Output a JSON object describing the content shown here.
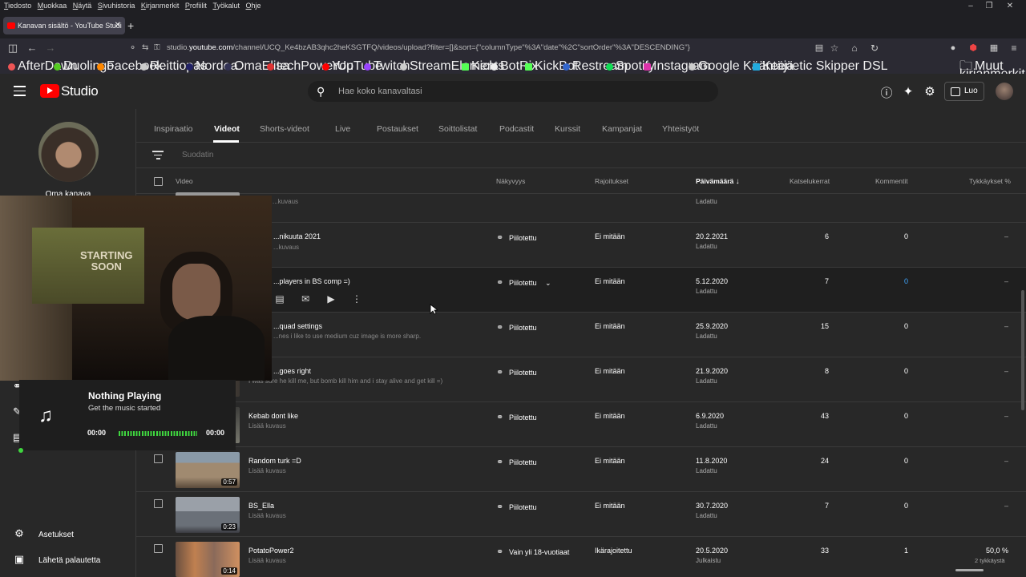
{
  "menubar": {
    "items": [
      "Tiedosto",
      "Muokkaa",
      "Näytä",
      "Sivuhistoria",
      "Kirjanmerkit",
      "Profiilit",
      "Työkalut",
      "Ohje"
    ]
  },
  "browser": {
    "tab_title": "Kanavan sisältö - YouTube Studi",
    "url_prefix": "studio.",
    "url_host": "youtube.com",
    "url_rest": "/channel/UCQ_Ke4bzAB3qhc2heKSGTFQ/videos/upload?filter=[]&sort={\"columnType\"%3A\"date\"%2C\"sortOrder\"%3A\"DESCENDING\"}",
    "bookmarks": [
      "AfterDawn",
      "Duolingo",
      "Facebook",
      "Reittiopas",
      "Nordea",
      "OmaElisa",
      "techPowerUp",
      "YouTube",
      "Twitch",
      "StreamElements",
      "Kick",
      "BotRix",
      "KickBot",
      "Restream",
      "Spotify",
      "Instagram",
      "Google Kääntäjä",
      "Keenetic Skipper DSL"
    ],
    "other_bookmarks": "Muut kirjanmerkit"
  },
  "header": {
    "logo_text": "Studio",
    "search_placeholder": "Hae koko kanavaltasi",
    "create_label": "Luo"
  },
  "sidebar": {
    "channel_name": "Oma kanava",
    "settings_label": "Asetukset",
    "feedback_label": "Lähetä palautetta",
    "partial_label": "Asetus"
  },
  "tabs": [
    "Inspiraatio",
    "Videot",
    "Shorts-videot",
    "Live",
    "Postaukset",
    "Soittolistat",
    "Podcastit",
    "Kurssit",
    "Kampanjat",
    "Yhteistyöt"
  ],
  "filter_placeholder": "Suodatin",
  "columns": {
    "video": "Video",
    "visibility": "Näkyvyys",
    "restrictions": "Rajoitukset",
    "date": "Päivämäärä",
    "views": "Katselukerrat",
    "comments": "Kommentit",
    "likes": "Tykkäykset %"
  },
  "rows": [
    {
      "title": "",
      "desc": "...kuvaus",
      "visibility": "",
      "restriction": "",
      "date": "",
      "status": "Ladattu",
      "views": "",
      "comments": "",
      "likes": ""
    },
    {
      "title": "...nikuuta 2021",
      "desc": "...kuvaus",
      "visibility": "Piilotettu",
      "restriction": "Ei mitään",
      "date": "20.2.2021",
      "status": "Ladattu",
      "views": "6",
      "comments": "0",
      "likes": "–"
    },
    {
      "title": "...players in BS comp =)",
      "desc": "",
      "visibility": "Piilotettu",
      "restriction": "Ei mitään",
      "date": "5.12.2020",
      "status": "Ladattu",
      "views": "7",
      "comments": "0",
      "likes": "–"
    },
    {
      "title": "...quad settings",
      "desc": "...nes i like to use medium cuz image is more sharp.",
      "visibility": "Piilotettu",
      "restriction": "Ei mitään",
      "date": "25.9.2020",
      "status": "Ladattu",
      "views": "15",
      "comments": "0",
      "likes": "–"
    },
    {
      "title": "...goes right",
      "desc": "I was sure he kill me, but bomb kill him and i stay alive and get kill =)",
      "visibility": "Piilotettu",
      "restriction": "Ei mitään",
      "date": "21.9.2020",
      "status": "Ladattu",
      "views": "8",
      "comments": "0",
      "likes": "–"
    },
    {
      "title": "Kebab dont like",
      "desc": "Lisää kuvaus",
      "visibility": "Piilotettu",
      "restriction": "Ei mitään",
      "date": "6.9.2020",
      "status": "Ladattu",
      "views": "43",
      "comments": "0",
      "likes": "–"
    },
    {
      "title": "Random turk =D",
      "desc": "Lisää kuvaus",
      "visibility": "Piilotettu",
      "restriction": "Ei mitään",
      "date": "11.8.2020",
      "status": "Ladattu",
      "views": "24",
      "comments": "0",
      "likes": "–",
      "duration": "0:57"
    },
    {
      "title": "BS_Ella",
      "desc": "Lisää kuvaus",
      "visibility": "Piilotettu",
      "restriction": "Ei mitään",
      "date": "30.7.2020",
      "status": "Ladattu",
      "views": "7",
      "comments": "0",
      "likes": "–",
      "duration": "0:23"
    },
    {
      "title": "PotatoPower2",
      "desc": "Lisää kuvaus",
      "visibility": "Vain yli 18-vuotiaat",
      "restriction": "Ikärajoitettu",
      "date": "20.5.2020",
      "status": "Julkaistu",
      "views": "33",
      "comments": "1",
      "likes": "50,0 %",
      "likes_sub": "2 tykkäystä",
      "duration": "0:14"
    }
  ],
  "overlay": {
    "np_title": "Nothing Playing",
    "np_sub": "Get the music started",
    "np_time_start": "00:00",
    "np_time_end": "00:00",
    "cam_poster_line1": "STARTING",
    "cam_poster_line2": "SOON"
  },
  "colors": {
    "accent_red": "#ff0000",
    "link_blue": "#3ea6ff",
    "np_green": "#3fd63f"
  }
}
